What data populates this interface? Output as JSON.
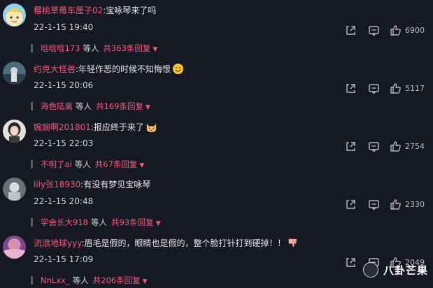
{
  "comments": [
    {
      "username": "樱桃草莓车厘子02",
      "text": ":宝咏琴来了吗",
      "time": "22-1-15 19:40",
      "likes": "6900",
      "reply_user": "晗晗晗173",
      "reply_wait": "等人",
      "reply_count": "共363条回复",
      "avatar_color": "#f2c94c"
    },
    {
      "username": "约克大怪兽",
      "text": ":年轻作恶的时候不知悔恨",
      "time": "22-1-15 20:06",
      "likes": "5117",
      "reply_user": "海色陆离",
      "reply_wait": "等人",
      "reply_count": "共169条回复",
      "avatar_color": "#6f8fa3"
    },
    {
      "username": "婉婉啊201801",
      "text": ":报应终于来了",
      "time": "22-1-15 22:03",
      "likes": "2754",
      "reply_user": "不明了ai",
      "reply_wait": "等人",
      "reply_count": "共67条回复",
      "avatar_color": "#c7c2bd"
    },
    {
      "username": "lily张18930",
      "text": ":有没有梦见宝咏琴",
      "time": "22-1-15 20:48",
      "likes": "2330",
      "reply_user": "学会长大918",
      "reply_wait": "等人",
      "reply_count": "共93条回复",
      "avatar_color": "#9aa0a6"
    },
    {
      "username": "流浪地球yyy",
      "text": ":眉毛是假的，眼睛也是假的，整个脸打针打到硬掉！！",
      "time": "22-1-15 17:09",
      "likes": "2049",
      "reply_user": "NnLxx_",
      "reply_wait": "等人",
      "reply_count": "共206条回复",
      "avatar_color": "#d98fb0"
    }
  ],
  "watermark": "八卦芒果",
  "colors": {
    "background": "#161823",
    "username": "#f05b7a",
    "text": "#e8e8ea"
  }
}
